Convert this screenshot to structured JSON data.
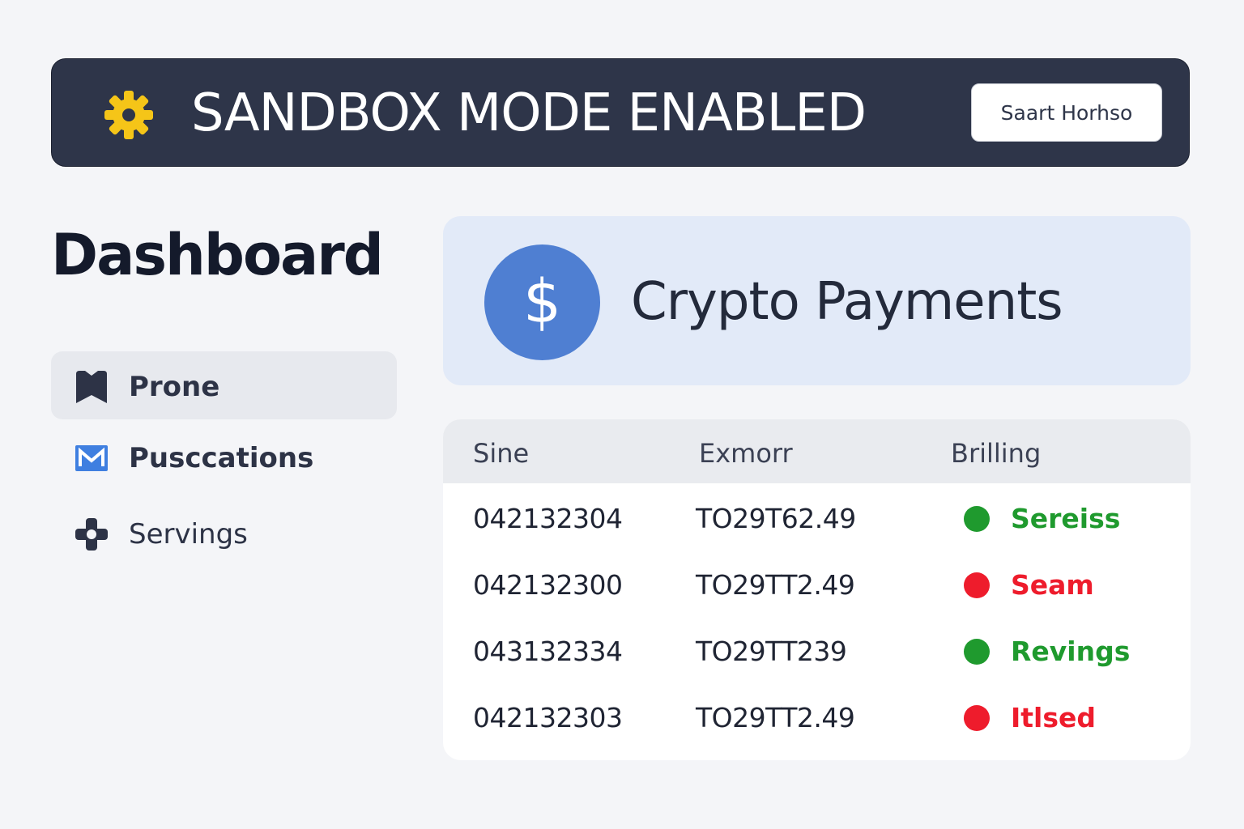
{
  "banner": {
    "title": "SANDBOX MODE ENABLED",
    "button_label": "Saart Horhso",
    "icon": "gear-icon",
    "icon_color": "#f5c518",
    "background_color": "#2e3549"
  },
  "sidebar": {
    "title": "Dashboard",
    "items": [
      {
        "label": "Prone",
        "icon": "bookmark-icon",
        "active": true
      },
      {
        "label": "Pusccations",
        "icon": "mail-icon",
        "active": false
      },
      {
        "label": "Servings",
        "icon": "move-icon",
        "active": false
      }
    ]
  },
  "crypto_card": {
    "icon": "dollar-icon",
    "icon_glyph": "$",
    "title": "Crypto Payments",
    "accent_color": "#4f7fd2"
  },
  "table": {
    "columns": [
      "Sine",
      "Exmorr",
      "Brilling"
    ],
    "rows": [
      {
        "id": "042132304",
        "amount": "TO29T62.49",
        "status": "Sereiss",
        "status_color": "#1f9a2e"
      },
      {
        "id": "042132300",
        "amount": "TO29TT2.49",
        "status": "Seam",
        "status_color": "#ee1c2c"
      },
      {
        "id": "043132334",
        "amount": "TO29TT239",
        "status": "Revings",
        "status_color": "#1f9a2e"
      },
      {
        "id": "042132303",
        "amount": "TO29TT2.49",
        "status": "Itlsed",
        "status_color": "#ee1c2c"
      }
    ]
  }
}
